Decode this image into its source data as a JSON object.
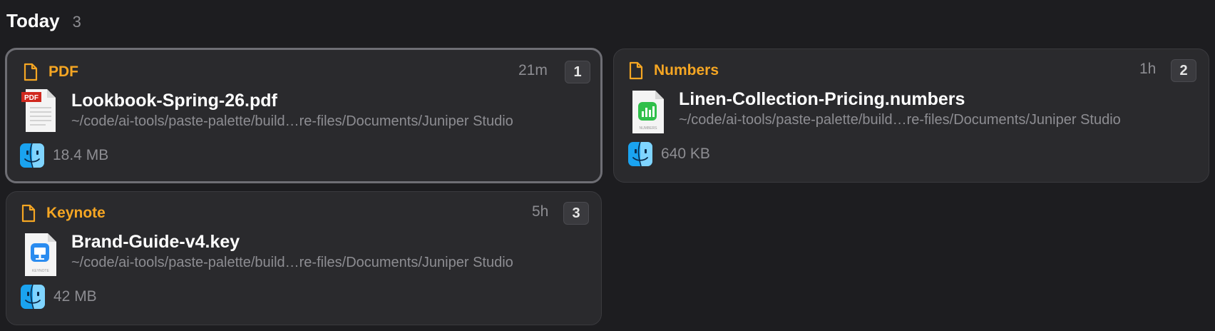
{
  "section": {
    "title": "Today",
    "count": "3"
  },
  "colors": {
    "accent": "#f5a623",
    "muted": "#8d8d92",
    "card_bg": "#2a2a2d",
    "app_bg": "#1d1d20"
  },
  "items": [
    {
      "type_label": "PDF",
      "time": "21m",
      "shortcut": "1",
      "file_name": "Lookbook-Spring-26.pdf",
      "path": "~/code/ai-tools/paste-palette/build…re-files/Documents/Juniper Studio",
      "size": "18.4 MB",
      "thumb_icon": "pdf-file-icon",
      "thumb_label": "PDF",
      "source_icon": "finder-icon",
      "selected": true
    },
    {
      "type_label": "Numbers",
      "time": "1h",
      "shortcut": "2",
      "file_name": "Linen-Collection-Pricing.numbers",
      "path": "~/code/ai-tools/paste-palette/build…re-files/Documents/Juniper Studio",
      "size": "640 KB",
      "thumb_icon": "numbers-file-icon",
      "thumb_label": "NUMBERS",
      "source_icon": "finder-icon",
      "selected": false
    },
    {
      "type_label": "Keynote",
      "time": "5h",
      "shortcut": "3",
      "file_name": "Brand-Guide-v4.key",
      "path": "~/code/ai-tools/paste-palette/build…re-files/Documents/Juniper Studio",
      "size": "42 MB",
      "thumb_icon": "keynote-file-icon",
      "thumb_label": "KEYNOTE",
      "source_icon": "finder-icon",
      "selected": false
    }
  ]
}
